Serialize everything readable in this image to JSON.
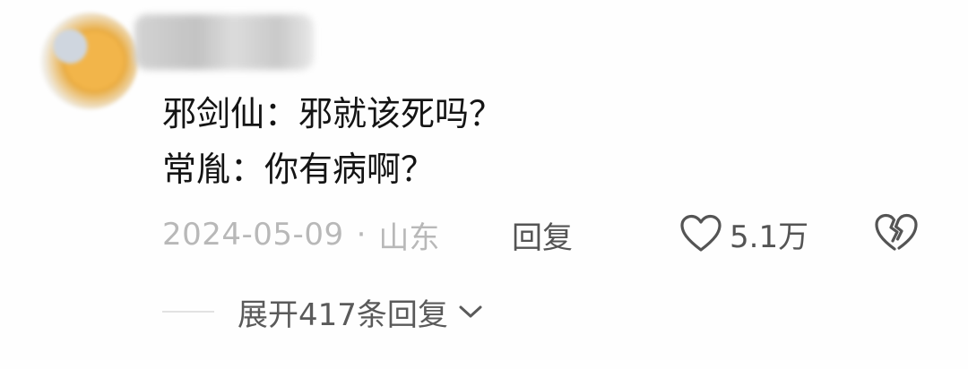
{
  "comment": {
    "lines": [
      "邪剑仙：邪就该死吗？",
      "常胤：你有病啊？"
    ]
  },
  "meta": {
    "date": "2024-05-09",
    "separator": "·",
    "location": "山东"
  },
  "actions": {
    "reply_label": "回复",
    "like_count": "5.1万"
  },
  "expand": {
    "label": "展开417条回复"
  },
  "colors": {
    "text_primary": "#141414",
    "text_secondary": "#545454",
    "text_meta": "#b8b8b8"
  },
  "icons": {
    "like": "heart-outline-icon",
    "dislike": "broken-heart-icon",
    "expand": "chevron-down-icon"
  }
}
